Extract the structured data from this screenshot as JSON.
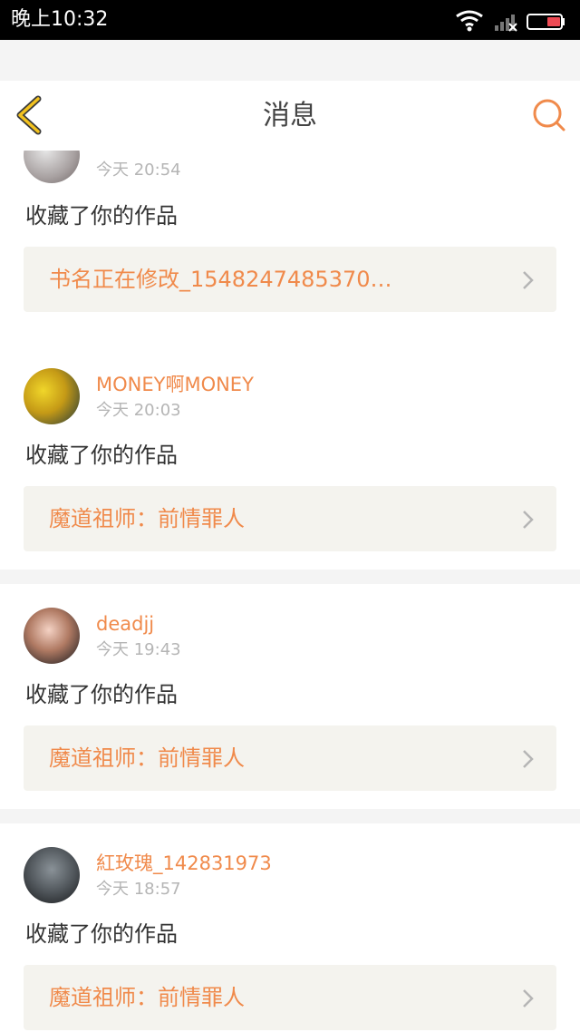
{
  "status_bar": {
    "time": "晚上10:32",
    "icons": [
      "wifi-icon",
      "signal-icon",
      "battery-icon"
    ]
  },
  "header": {
    "title": "消息",
    "back_icon": "chevron-left-icon",
    "search_icon": "search-icon"
  },
  "colors": {
    "accent": "#f08a4b",
    "icon_yellow": "#f3c21e",
    "background": "#f4f4f4",
    "card_box": "#f4f3ee"
  },
  "notifications": [
    {
      "username": "",
      "time": "今天 20:54",
      "action": "收藏了你的作品",
      "work_title": "书名正在修改_1548247485370…"
    },
    {
      "username": "MONEY啊MONEY",
      "time": "今天 20:03",
      "action": "收藏了你的作品",
      "work_title": "魔道祖师：前情罪人"
    },
    {
      "username": "deadjj",
      "time": "今天 19:43",
      "action": "收藏了你的作品",
      "work_title": "魔道祖师：前情罪人"
    },
    {
      "username": "紅玫瑰_142831973",
      "time": "今天 18:57",
      "action": "收藏了你的作品",
      "work_title": "魔道祖师：前情罪人"
    }
  ]
}
